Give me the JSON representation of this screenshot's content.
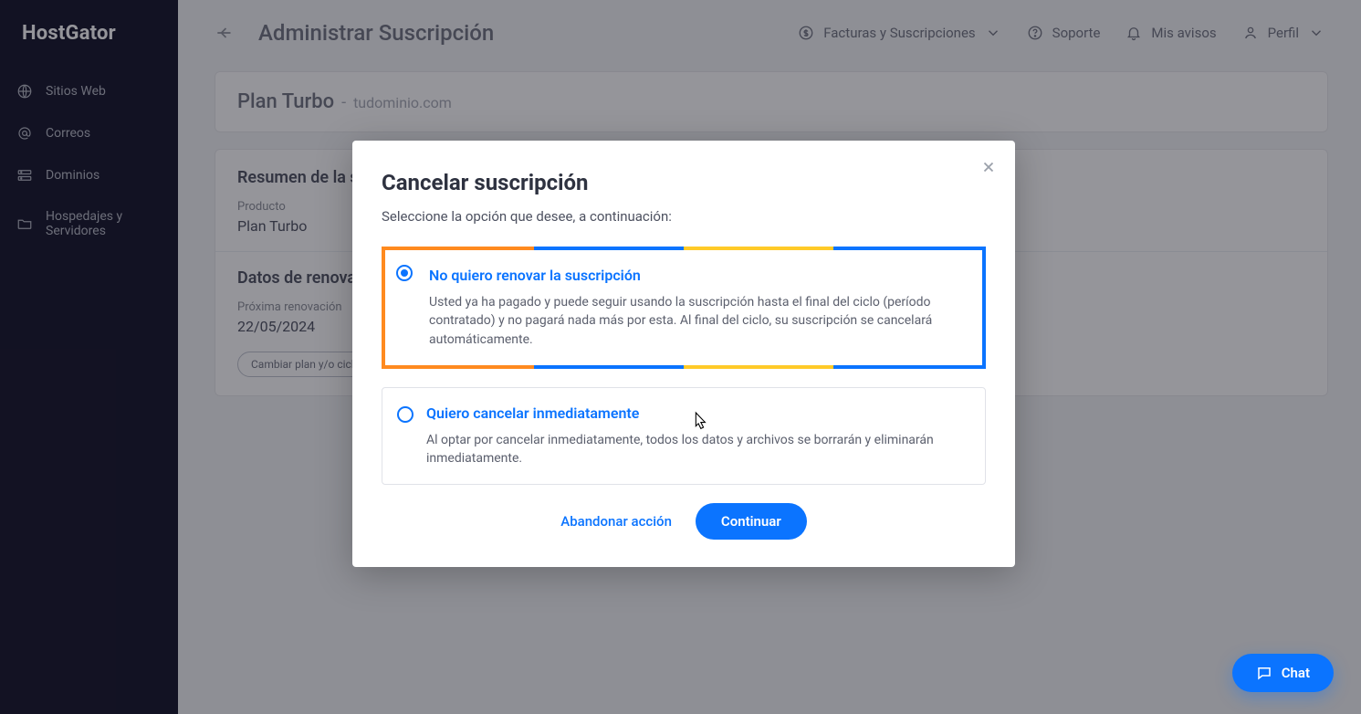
{
  "brand": "HostGator",
  "sidebar": {
    "items": [
      {
        "label": "Sitios Web",
        "icon": "globe-icon"
      },
      {
        "label": "Correos",
        "icon": "at-icon"
      },
      {
        "label": "Dominios",
        "icon": "server-icon"
      },
      {
        "label": "Hospedajes y Servidores",
        "icon": "folder-icon"
      }
    ]
  },
  "topbar": {
    "page_title": "Administrar Suscripción",
    "links": {
      "billing": "Facturas y Suscripciones",
      "support": "Soporte",
      "notices": "Mis avisos",
      "profile": "Perfil"
    }
  },
  "subscription_card": {
    "plan_name": "Plan Turbo",
    "domain": "tudominio.com"
  },
  "summary": {
    "title": "Resumen de la suscripción",
    "product_label": "Producto",
    "product_value": "Plan Turbo"
  },
  "renewal": {
    "title": "Datos de renovación",
    "next_label": "Próxima renovación",
    "next_value": "22/05/2024",
    "change_plan_label": "Cambiar plan y/o ciclo"
  },
  "modal": {
    "title": "Cancelar suscripción",
    "subtitle": "Seleccione la opción que desee, a continuación:",
    "option1": {
      "title": "No quiero renovar la suscripción",
      "desc": "Usted ya ha pagado y puede seguir usando la suscripción hasta el final del ciclo (período contratado) y no pagará nada más por esta. Al final del ciclo, su suscripción se cancelará automáticamente."
    },
    "option2": {
      "title": "Quiero cancelar inmediatamente",
      "desc": "Al optar por cancelar inmediatamente, todos los datos y archivos se borrarán y eliminarán inmediatamente."
    },
    "abandon": "Abandonar acción",
    "continue": "Continuar"
  },
  "chat_label": "Chat"
}
